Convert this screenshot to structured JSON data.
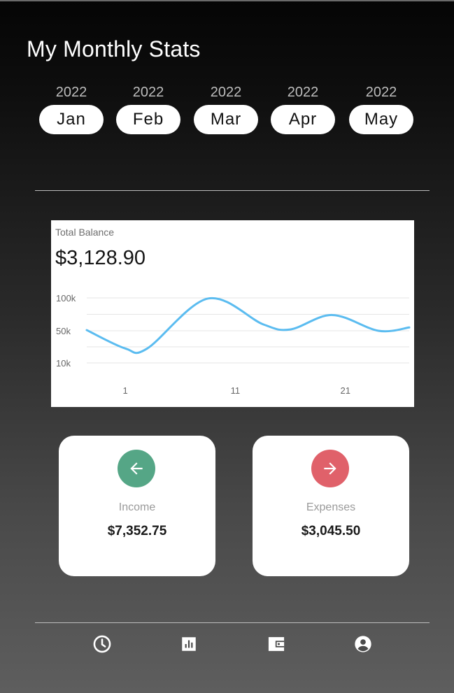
{
  "header": {
    "title": "My Monthly Stats"
  },
  "months": [
    {
      "year": "2022",
      "label": "Jan"
    },
    {
      "year": "2022",
      "label": "Feb"
    },
    {
      "year": "2022",
      "label": "Mar"
    },
    {
      "year": "2022",
      "label": "Apr"
    },
    {
      "year": "2022",
      "label": "May"
    }
  ],
  "balance": {
    "label": "Total Balance",
    "value": "$3,128.90"
  },
  "chart_data": {
    "type": "line",
    "ytick_labels": [
      "100k",
      "50k",
      "10k"
    ],
    "xtick_labels": [
      "1",
      "11",
      "21"
    ],
    "series": [
      {
        "x": [
          -2.5,
          1,
          3,
          8.5,
          13.5,
          16,
          19.8,
          24,
          26.8
        ],
        "values": [
          51000,
          28000,
          28000,
          99000,
          60000,
          52000,
          74000,
          50000,
          55000
        ]
      }
    ],
    "colors": {
      "line": "#5bbcf0",
      "grid": "#e6e6e6"
    }
  },
  "income": {
    "label": "Income",
    "value": "$7,352.75",
    "icon": "arrow-left-icon",
    "color": "#55a686"
  },
  "expenses": {
    "label": "Expenses",
    "value": "$3,045.50",
    "icon": "arrow-right-icon",
    "color": "#e0616a"
  },
  "nav": [
    {
      "icon": "clock-icon"
    },
    {
      "icon": "bar-chart-icon"
    },
    {
      "icon": "wallet-icon"
    },
    {
      "icon": "account-icon"
    }
  ]
}
